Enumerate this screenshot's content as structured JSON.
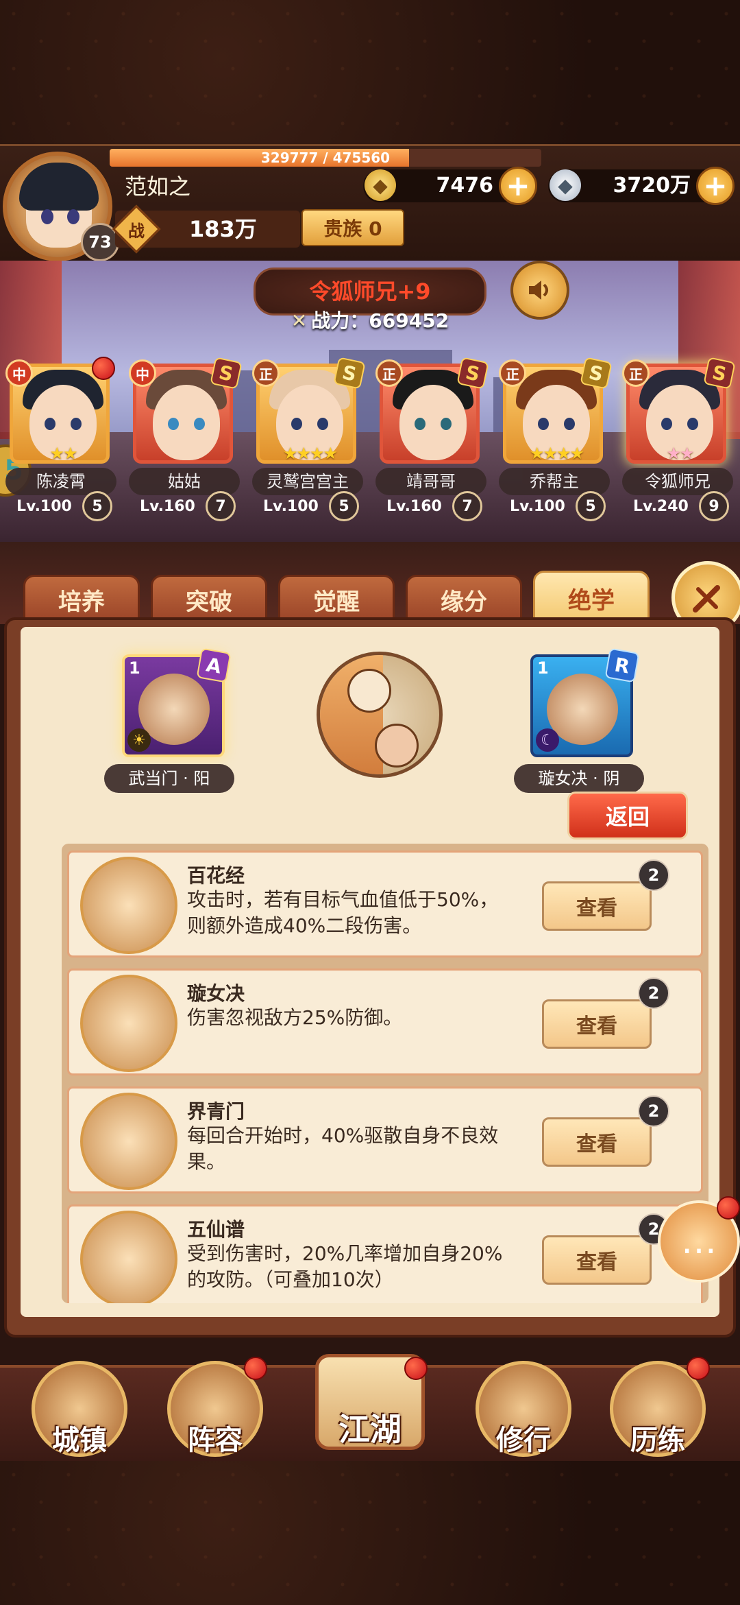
{
  "player": {
    "name": "范如之",
    "level": "73",
    "exp_text": "329777 / 475560",
    "exp_fraction": 0.6934,
    "gold": "7476",
    "silver": "3720万",
    "power_label": "战",
    "power": "183万",
    "noble": "贵族 0"
  },
  "scene": {
    "title": "令狐师兄+9",
    "battle_label": "战力：",
    "battle_value": "669452"
  },
  "heroes": [
    {
      "name": "陈凌霄",
      "lv": "Lv.100",
      "rank": "5",
      "tag": "中",
      "stars": "★★",
      "card": "orange"
    },
    {
      "name": "姑姑",
      "lv": "Lv.160",
      "rank": "7",
      "tag": "中",
      "stars": "",
      "card": "red"
    },
    {
      "name": "灵鹫宫宫主",
      "lv": "Lv.100",
      "rank": "5",
      "tag": "正",
      "stars": "★★★★",
      "card": "orange"
    },
    {
      "name": "靖哥哥",
      "lv": "Lv.160",
      "rank": "7",
      "tag": "正",
      "stars": "",
      "card": "red"
    },
    {
      "name": "乔帮主",
      "lv": "Lv.100",
      "rank": "5",
      "tag": "正",
      "stars": "★★★★",
      "card": "orange"
    },
    {
      "name": "令狐师兄",
      "lv": "Lv.240",
      "rank": "9",
      "tag": "正",
      "stars": "★★",
      "card": "red"
    }
  ],
  "tabs": [
    "培养",
    "突破",
    "觉醒",
    "缘分",
    "绝学"
  ],
  "active_tab": "绝学",
  "skills": {
    "left": {
      "num": "1",
      "grade": "A",
      "label": "武当门 · 阳"
    },
    "right": {
      "num": "1",
      "grade": "R",
      "label": "璇女决 · 阴"
    }
  },
  "back_label": "返回",
  "list": [
    {
      "title": "百花经",
      "desc": "攻击时，若有目标气血值低于50%，则额外造成40%二段伤害。",
      "btn": "查看",
      "count": "2"
    },
    {
      "title": "璇女决",
      "desc": "伤害忽视敌方25%防御。",
      "btn": "查看",
      "count": "2"
    },
    {
      "title": "界青门",
      "desc": "每回合开始时，40%驱散自身不良效果。",
      "btn": "查看",
      "count": "2"
    },
    {
      "title": "五仙谱",
      "desc": "受到伤害时，20%几率增加自身20%的攻防。（可叠加10次）",
      "btn": "查看",
      "count": "2"
    }
  ],
  "nav": [
    "城镇",
    "阵容",
    "江湖",
    "修行",
    "历练"
  ],
  "colors": {
    "accent": "#e7742c",
    "panel": "#f6e7cb",
    "active_tab": "#f3c86e"
  }
}
